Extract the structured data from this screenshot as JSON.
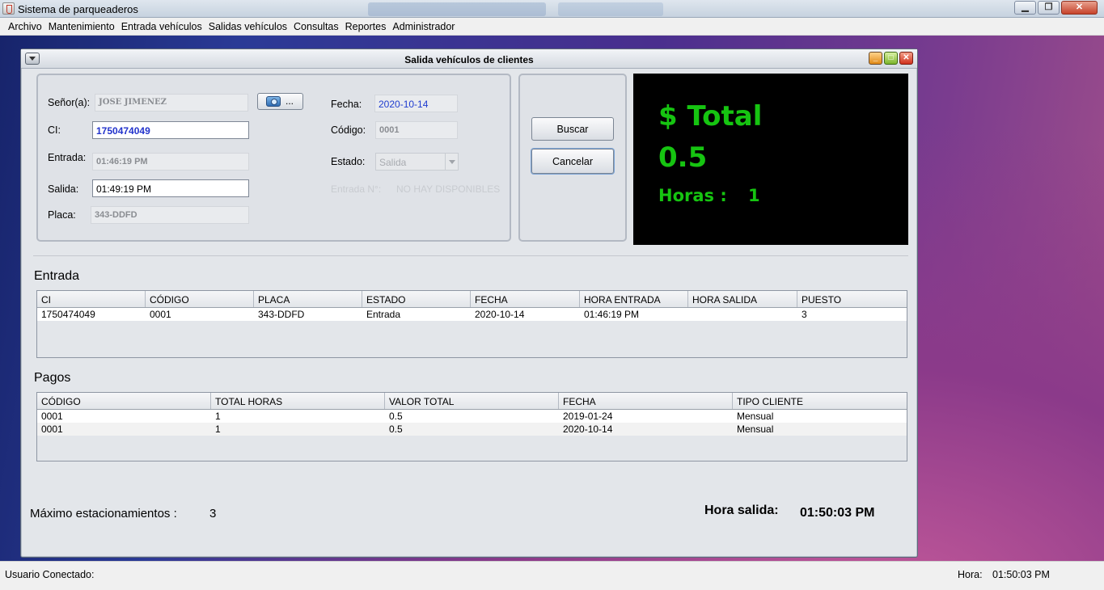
{
  "app": {
    "title": "Sistema de parqueaderos"
  },
  "menubar": [
    "Archivo",
    "Mantenimiento",
    "Entrada vehículos",
    "Salidas vehículos",
    "Consultas",
    "Reportes",
    "Administrador"
  ],
  "frame": {
    "title": "Salida vehículos de clientes"
  },
  "form": {
    "senor_label": "Señor(a):",
    "senor_value": "JOSE JIMENEZ",
    "ci_label": "CI:",
    "ci_value": "1750474049",
    "entrada_label": "Entrada:",
    "entrada_value": "01:46:19 PM",
    "salida_label": "Salida:",
    "salida_value": "01:49:19 PM",
    "placa_label": "Placa:",
    "placa_value": "343-DDFD",
    "camera_button_dots": "...",
    "fecha_label": "Fecha:",
    "fecha_value": "2020-10-14",
    "codigo_label": "Código:",
    "codigo_value": "0001",
    "estado_label": "Estado:",
    "estado_value": "Salida",
    "entrada_n_label": "Entrada N°:",
    "entrada_n_value": "NO HAY DISPONIBLES"
  },
  "actions": {
    "buscar": "Buscar",
    "cancelar": "Cancelar"
  },
  "display": {
    "total_label": "$ Total",
    "total_value": "0.5",
    "horas_label": "Horas :",
    "horas_value": "1",
    "text_color": "#16c411",
    "background": "#000000"
  },
  "entrada_section": {
    "title": "Entrada",
    "columns": [
      "CI",
      "CÓDIGO",
      "PLACA",
      "ESTADO",
      "FECHA",
      "HORA ENTRADA",
      "HORA SALIDA",
      "PUESTO"
    ],
    "rows": [
      [
        "1750474049",
        "0001",
        "343-DDFD",
        "Entrada",
        "2020-10-14",
        "01:46:19 PM",
        "",
        "3"
      ]
    ]
  },
  "pagos_section": {
    "title": "Pagos",
    "columns": [
      "CÓDIGO",
      "TOTAL HORAS",
      "VALOR TOTAL",
      "FECHA",
      "TIPO CLIENTE"
    ],
    "rows": [
      [
        "0001",
        "1",
        "0.5",
        "2019-01-24",
        "Mensual"
      ],
      [
        "0001",
        "1",
        "0.5",
        "2020-10-14",
        "Mensual"
      ]
    ]
  },
  "footer": {
    "max_label": "Máximo estacionamientos :",
    "max_value": "3",
    "hora_salida_label": "Hora salida:",
    "hora_salida_value": "01:50:03 PM"
  },
  "statusbar": {
    "user_label": "Usuario Conectado:",
    "hora_label": "Hora:",
    "hora_value": "01:50:03 PM"
  }
}
